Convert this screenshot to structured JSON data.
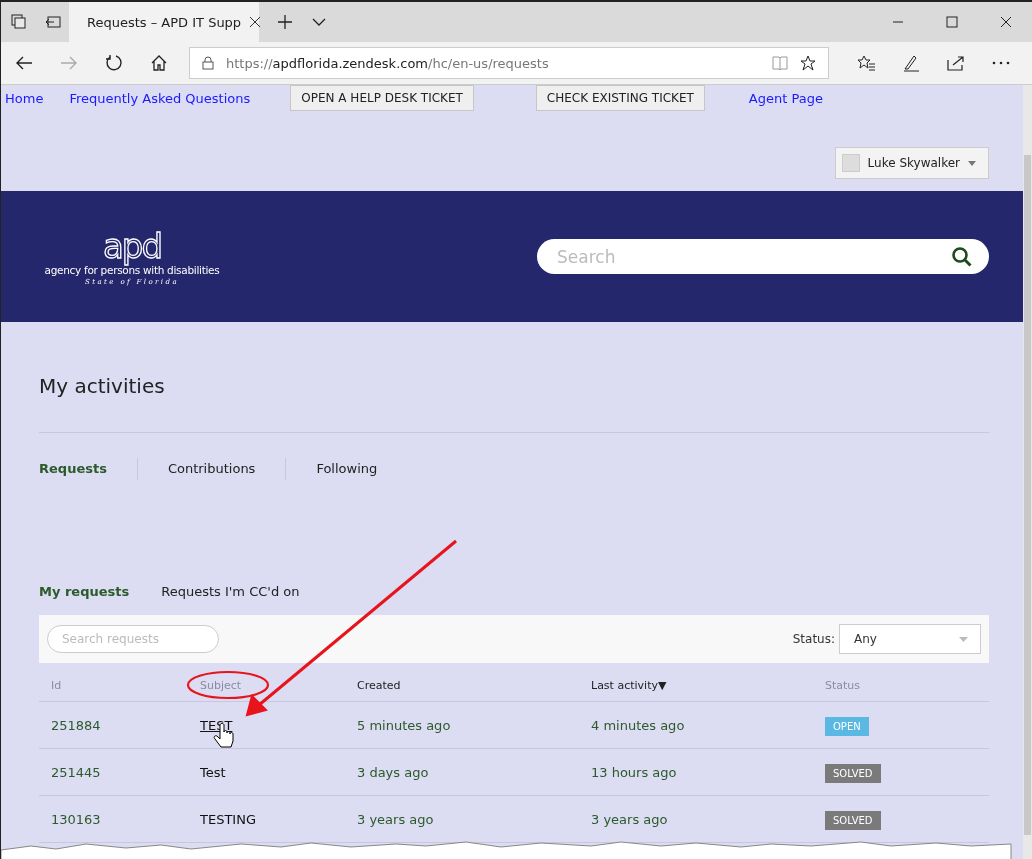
{
  "browser": {
    "tab_title": "Requests – APD IT Supp",
    "url": {
      "scheme": "https://",
      "domain": "apdflorida.zendesk.com",
      "path": "/hc/en-us/requests"
    }
  },
  "nav": [
    {
      "label": "Home",
      "kind": "link"
    },
    {
      "label": "Frequently Asked Questions",
      "kind": "link"
    },
    {
      "label": "OPEN A HELP DESK TICKET",
      "kind": "button"
    },
    {
      "label": "CHECK EXISTING TICKET",
      "kind": "button"
    },
    {
      "label": "Agent Page",
      "kind": "link"
    }
  ],
  "user_menu": {
    "name": "Luke Skywalker"
  },
  "header": {
    "logo": "apd",
    "agency": "agency for persons with disabilities",
    "state": "State of Florida",
    "search_placeholder": "Search"
  },
  "page_title": "My activities",
  "tabs": [
    {
      "label": "Requests",
      "selected": true
    },
    {
      "label": "Contributions",
      "selected": false
    },
    {
      "label": "Following",
      "selected": false
    }
  ],
  "subtabs": [
    {
      "label": "My requests",
      "selected": true
    },
    {
      "label": "Requests I'm CC'd on",
      "selected": false
    }
  ],
  "filter": {
    "search_placeholder": "Search requests",
    "status_label": "Status:",
    "status_value": "Any"
  },
  "table": {
    "columns": [
      {
        "label": "Id",
        "sortable": false
      },
      {
        "label": "Subject",
        "sortable": false
      },
      {
        "label": "Created",
        "sortable": true
      },
      {
        "label": "Last activity▼",
        "sortable": true
      },
      {
        "label": "Status",
        "sortable": false
      }
    ],
    "rows": [
      {
        "id": "251884",
        "subject": "TEST",
        "hovered": true,
        "created": "5 minutes ago",
        "last_activity": "4 minutes ago",
        "status": {
          "label": "OPEN",
          "kind": "open"
        }
      },
      {
        "id": "251445",
        "subject": "Test",
        "hovered": false,
        "created": "3 days ago",
        "last_activity": "13 hours ago",
        "status": {
          "label": "SOLVED",
          "kind": "solved"
        }
      },
      {
        "id": "130163",
        "subject": "TESTING",
        "hovered": false,
        "created": "3 years ago",
        "last_activity": "3 years ago",
        "status": {
          "label": "SOLVED",
          "kind": "solved"
        }
      }
    ]
  }
}
